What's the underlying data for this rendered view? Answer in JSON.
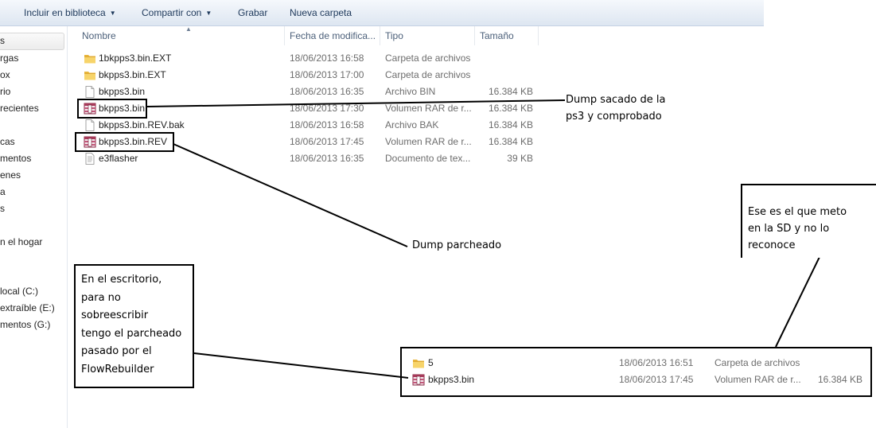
{
  "toolbar": {
    "include_library": "Incluir en biblioteca",
    "share_with": "Compartir con",
    "burn": "Grabar",
    "new_folder": "Nueva carpeta"
  },
  "nav": {
    "items": [
      "s",
      "rgas",
      "ox",
      "rio",
      "recientes",
      "cas",
      "mentos",
      "enes",
      "a",
      "s",
      "n el hogar",
      "local (C:)",
      "extraíble (E:)",
      "mentos (G:)"
    ]
  },
  "columns": {
    "name": "Nombre",
    "date": "Fecha de modifica...",
    "type": "Tipo",
    "size": "Tamaño"
  },
  "files": [
    {
      "name": "1bkpps3.bin.EXT",
      "date": "18/06/2013 16:58",
      "type": "Carpeta de archivos",
      "size": "",
      "icon": "folder-icon"
    },
    {
      "name": "bkpps3.bin.EXT",
      "date": "18/06/2013 17:00",
      "type": "Carpeta de archivos",
      "size": "",
      "icon": "folder-icon"
    },
    {
      "name": "bkpps3.bin",
      "date": "18/06/2013 16:35",
      "type": "Archivo BIN",
      "size": "16.384 KB",
      "icon": "file-icon"
    },
    {
      "name": "bkpps3.bin",
      "date": "18/06/2013 17:30",
      "type": "Volumen RAR de r...",
      "size": "16.384 KB",
      "icon": "rar-icon"
    },
    {
      "name": "bkpps3.bin.REV.bak",
      "date": "18/06/2013 16:58",
      "type": "Archivo BAK",
      "size": "16.384 KB",
      "icon": "file-icon"
    },
    {
      "name": "bkpps3.bin.REV",
      "date": "18/06/2013 17:45",
      "type": "Volumen RAR de r...",
      "size": "16.384 KB",
      "icon": "rar-icon"
    },
    {
      "name": "e3flasher",
      "date": "18/06/2013 16:35",
      "type": "Documento de tex...",
      "size": "39 KB",
      "icon": "text-file-icon"
    }
  ],
  "desktop_files": [
    {
      "name": "5",
      "date": "18/06/2013 16:51",
      "type": "Carpeta de archivos",
      "size": "",
      "icon": "folder-icon"
    },
    {
      "name": "bkpps3.bin",
      "date": "18/06/2013 17:45",
      "type": "Volumen RAR de r...",
      "size": "16.384 KB",
      "icon": "rar-icon"
    }
  ],
  "annotations": {
    "dump_original": [
      "Dump sacado de la",
      "ps3 y comprobado"
    ],
    "dump_patched": "Dump parcheado",
    "sd_note": [
      "Ese es el que meto",
      "en la SD y no lo",
      "reconoce"
    ],
    "desktop_note": [
      "En el escritorio,",
      "para no",
      "sobreescribir",
      "tengo el parcheado",
      "pasado por el",
      "FlowRebuilder"
    ]
  }
}
